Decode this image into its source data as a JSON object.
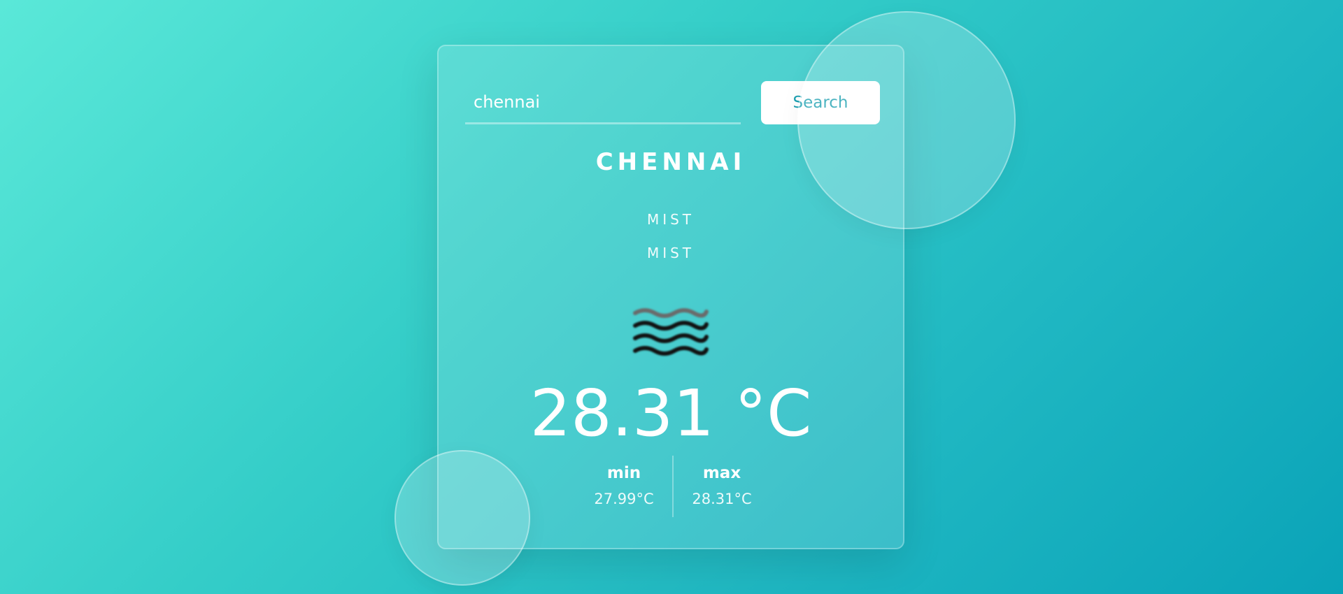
{
  "search": {
    "value": "chennai",
    "button_label": "Search"
  },
  "weather": {
    "city": "CHENNAI",
    "condition_main": "MIST",
    "condition_description": "MIST",
    "icon": "mist-icon",
    "temperature": "28.31 °C",
    "min_label": "min",
    "min_value": "27.99°C",
    "max_label": "max",
    "max_value": "28.31°C"
  },
  "colors": {
    "background_start": "#5ae8d8",
    "background_end": "#0aa3b8",
    "button_text": "#1a9fb0",
    "button_bg": "#ffffff",
    "text": "#ffffff"
  }
}
